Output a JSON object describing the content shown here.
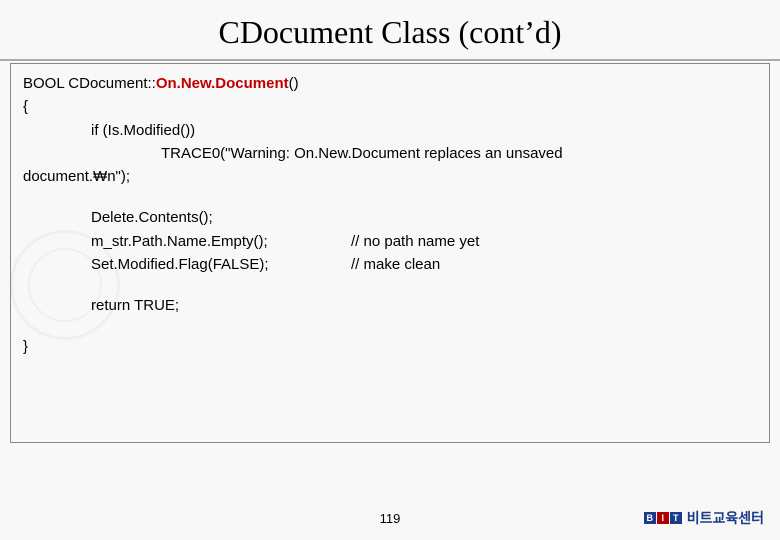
{
  "title": "CDocument Class (contʼd)",
  "code": {
    "sig_prefix": "BOOL CDocument::",
    "sig_func": "On.New.Document",
    "sig_suffix": "()",
    "brace_open": "{",
    "if_line": "if (Is.Modified())",
    "trace_a": "TRACE0(\"Warning: On.New.Document replaces an unsaved",
    "trace_b": "document.₩n\");",
    "del": "Delete.Contents();",
    "empty": "m_str.Path.Name.Empty();",
    "empty_cmt": "// no path name yet",
    "setmod": "Set.Modified.Flag(FALSE);",
    "setmod_cmt": "// make clean",
    "ret": "return TRUE;",
    "brace_close": "}"
  },
  "page_number": "119",
  "brand": {
    "b": "B",
    "i": "I",
    "t": "T",
    "text": "비트교육센터"
  }
}
